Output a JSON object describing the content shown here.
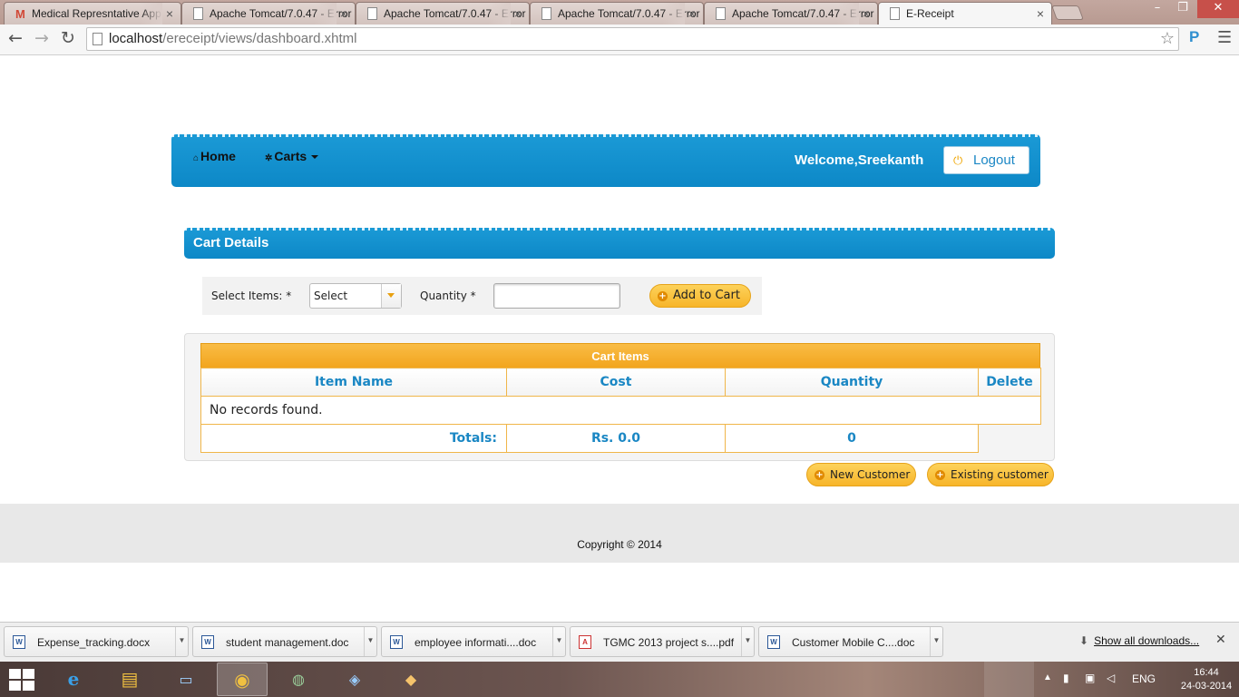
{
  "browser": {
    "tabs": [
      {
        "title": "Medical Represntative App",
        "icon": "gmail-icon"
      },
      {
        "title": "Apache Tomcat/7.0.47 - Error",
        "icon": "page-icon"
      },
      {
        "title": "Apache Tomcat/7.0.47 - Error",
        "icon": "page-icon"
      },
      {
        "title": "Apache Tomcat/7.0.47 - Error",
        "icon": "page-icon"
      },
      {
        "title": "Apache Tomcat/7.0.47 - Error",
        "icon": "page-icon"
      },
      {
        "title": "E-Receipt",
        "icon": "page-icon"
      }
    ],
    "url_host": "localhost",
    "url_path": "/ereceipt/views/dashboard.xhtml",
    "extension_label": "P"
  },
  "navbar": {
    "home_label": "Home",
    "carts_label": "Carts",
    "welcome_text": "Welcome,Sreekanth",
    "logout_label": "Logout"
  },
  "panel": {
    "title": "Cart Details"
  },
  "form": {
    "select_items_label": "Select Items: *",
    "select_value": "Select",
    "quantity_label": "Quantity *",
    "quantity_value": "",
    "add_to_cart_label": "Add to Cart"
  },
  "cart_table": {
    "caption": "Cart Items",
    "headers": [
      "Item Name",
      "Cost",
      "Quantity",
      "Delete"
    ],
    "empty_message": "No records found.",
    "totals_label": "Totals:",
    "total_cost": "Rs. 0.0",
    "total_quantity": "0"
  },
  "actions": {
    "new_customer_label": "New Customer",
    "existing_customer_label": "Existing customer"
  },
  "footer": {
    "copyright": "Copyright © 2014"
  },
  "downloads": {
    "items": [
      {
        "name": "Expense_tracking.docx",
        "type": "word"
      },
      {
        "name": "student management.doc",
        "type": "word"
      },
      {
        "name": "employee  informati....doc",
        "type": "word"
      },
      {
        "name": "TGMC 2013 project s....pdf",
        "type": "pdf"
      },
      {
        "name": "Customer Mobile C....doc",
        "type": "word"
      }
    ],
    "show_all_label": "Show all downloads..."
  },
  "taskbar": {
    "language": "ENG",
    "time": "16:44",
    "date": "24-03-2014"
  },
  "colors": {
    "brand_blue": "#0d88c7",
    "accent_orange": "#f7b52a",
    "header_text_blue": "#1a87c4"
  }
}
